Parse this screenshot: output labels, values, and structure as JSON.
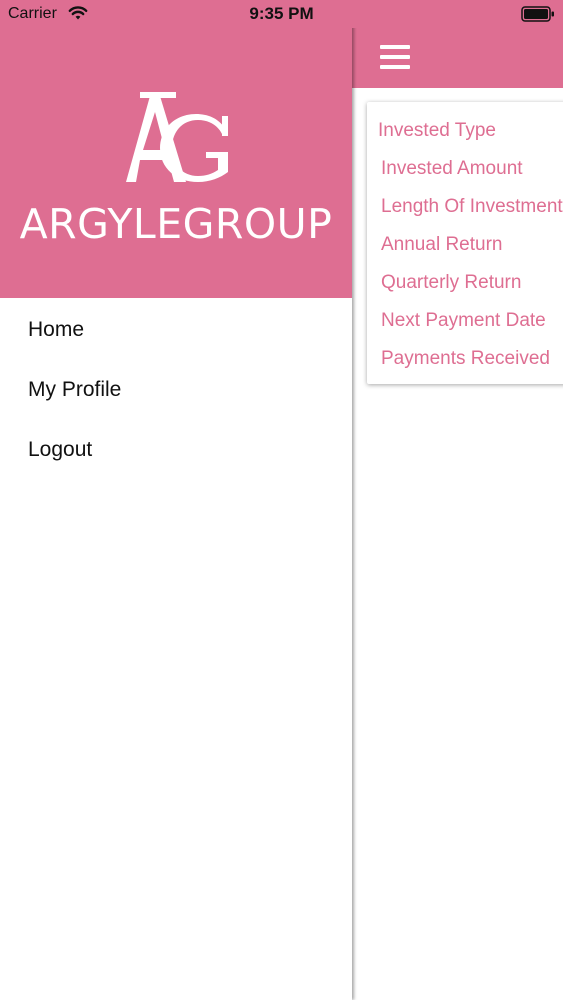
{
  "status_bar": {
    "carrier": "Carrier",
    "time": "9:35 PM",
    "wifi_icon": "wifi-icon",
    "battery_icon": "battery-icon"
  },
  "drawer": {
    "logo_word": "ARGYLEGROUP",
    "logo_mark_icon": "ag-monogram-icon",
    "menu": [
      {
        "label": "Home"
      },
      {
        "label": "My Profile"
      },
      {
        "label": "Logout"
      }
    ]
  },
  "main": {
    "menu_icon": "hamburger-icon",
    "card_rows": [
      "Invested Type",
      "Invested Amount",
      "Length Of Investment",
      "Annual Return",
      "Quarterly Return",
      "Next Payment Date",
      "Payments Received"
    ]
  },
  "colors": {
    "brand_pink": "#de6e92",
    "text_dark": "#111111",
    "white": "#ffffff"
  }
}
